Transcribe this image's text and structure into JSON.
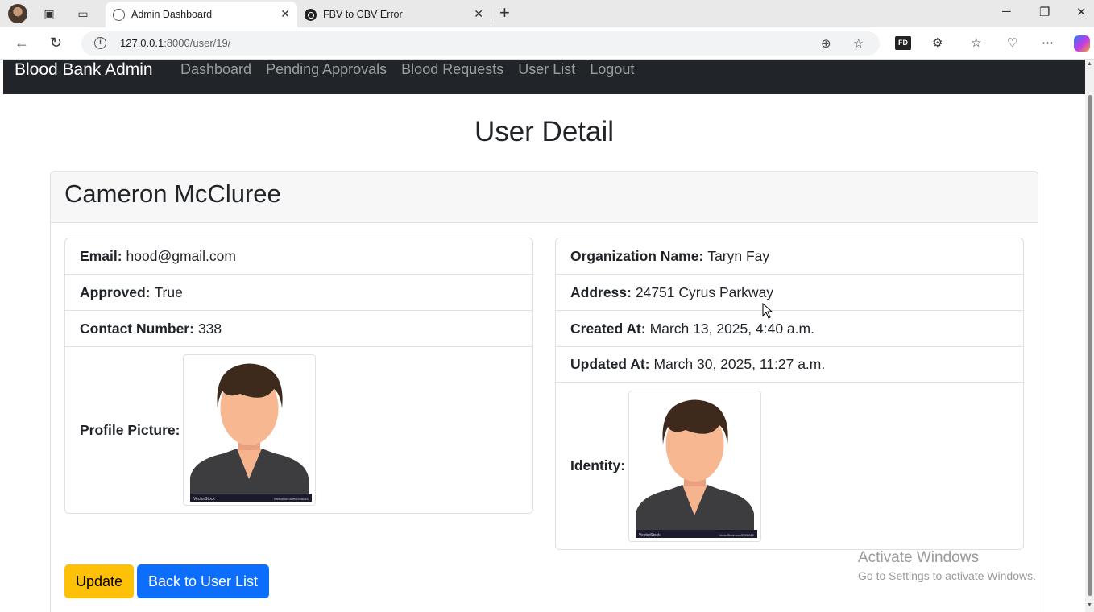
{
  "browser": {
    "tabs": [
      {
        "title": "Admin Dashboard",
        "active": true
      },
      {
        "title": "FBV to CBV Error",
        "active": false
      }
    ],
    "url_host": "127.0.0.1",
    "url_path": ":8000/user/19/"
  },
  "navbar": {
    "brand": "Blood Bank Admin",
    "links": [
      "Dashboard",
      "Pending Approvals",
      "Blood Requests",
      "User List",
      "Logout"
    ]
  },
  "page": {
    "title": "User Detail",
    "user_name": "Cameron McCluree"
  },
  "left_fields": [
    {
      "label": "Email:",
      "value": "hood@gmail.com"
    },
    {
      "label": "Approved:",
      "value": "True"
    },
    {
      "label": "Contact Number:",
      "value": "338"
    },
    {
      "label": "Profile Picture:",
      "value": ""
    }
  ],
  "right_fields": [
    {
      "label": "Organization Name:",
      "value": "Taryn Fay"
    },
    {
      "label": "Address:",
      "value": "24751 Cyrus Parkway"
    },
    {
      "label": "Created At:",
      "value": "March 13, 2025, 4:40 a.m."
    },
    {
      "label": "Updated At:",
      "value": "March 30, 2025, 11:27 a.m."
    },
    {
      "label": "Identity:",
      "value": ""
    }
  ],
  "buttons": {
    "update": "Update",
    "back": "Back to User List"
  },
  "image_watermark": {
    "brand": "VectorStock",
    "ref": "VectorStock.com/22956115"
  },
  "windows_watermark": {
    "line1": "Activate Windows",
    "line2": "Go to Settings to activate Windows."
  },
  "colors": {
    "navbar_bg": "#212529",
    "btn_warning": "#ffc107",
    "btn_primary": "#0d6efd"
  }
}
